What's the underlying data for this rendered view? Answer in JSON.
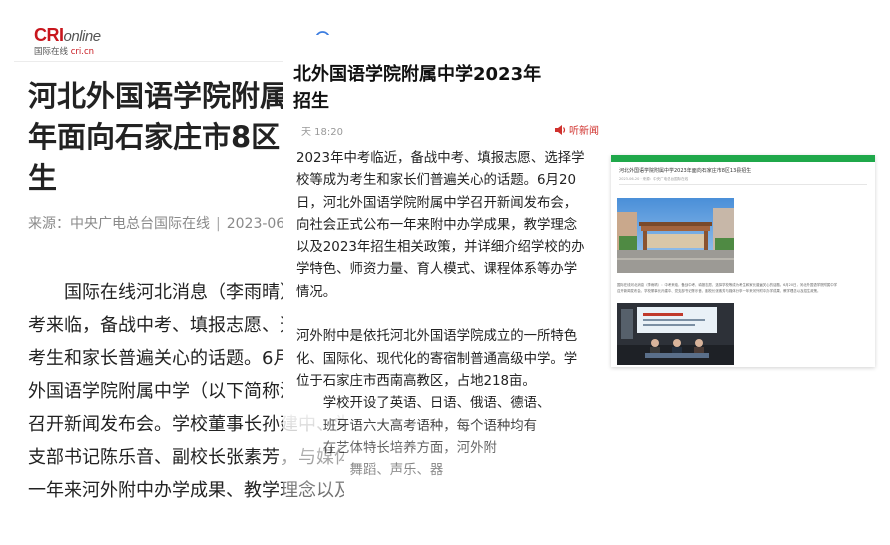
{
  "screen1": {
    "logo": {
      "brand_red": "CRI",
      "brand_grey": "online",
      "cn_name": "国际在线",
      "domain": "cri.cn"
    },
    "search_icon": "search-icon",
    "title": "河北外国语学院附属中学2023\n年面向石家庄市8区13县招\n生",
    "meta": {
      "source": "来源：中央广电总台国际在线",
      "date": "2023-06-20"
    },
    "body": "　　国际在线河北消息（李雨晴）：中\n考来临，备战中考、填报志愿、选择学校等成为\n考生和家长普遍关心的话题。6月20日，河北\n外国语学院附属中学（以下简称河外附中）\n召开新闻发布会。学校董事长孙建中、党\n支部书记陈乐音、副校长张素芳，与媒体分享\n一年来河外附中办学成果、教学理念以及"
  },
  "screen2": {
    "title": "北外国语学院附属中学2023年\n招生",
    "time": "天 18:20",
    "share": "听新闻",
    "body": "2023年中考临近，备战中考、填报志愿、选择学\n校等成为考生和家长们普遍关心的话题。6月20\n日，河北外国语学院附属中学召开新闻发布会，\n向社会正式公布一年来附中办学成果，教学理念\n以及2023年招生相关政策，并详细介绍学校的办\n学特色、师资力量、育人模式、课程体系等办学\n情况。\n\n河外附中是依托河北外国语学院成立的一所特色\n化、国际化、现代化的寄宿制普通高级中学。学\n位于石家庄市西南高教区，占地218亩。\n　　学校开设了英语、日语、俄语、德语、\n　　班牙语六大高考语种，每个语种均有\n　　在艺体特长培养方面，河外附\n　　　　舞蹈、声乐、器"
  },
  "screen3": {
    "title": "河北外国语学院附属中学2023年面向石家庄市8区13县招生",
    "meta": "2023-06-20 · 来源：中央广电总台国际在线",
    "caption": "国际在线河北消息（李雨晴）：中考来临，备战中考、填报志愿、选择学校等成为考生和家长普遍关心的话题。6月20日，河北外国语学院附属中学\n召开新闻发布会，学校董事长孙建中、党支部书记陈乐音、副校长张素芳与媒体分享一年来河外附中办学成果、教学理念以及招生政策。",
    "accent_color": "#1fa84a"
  }
}
